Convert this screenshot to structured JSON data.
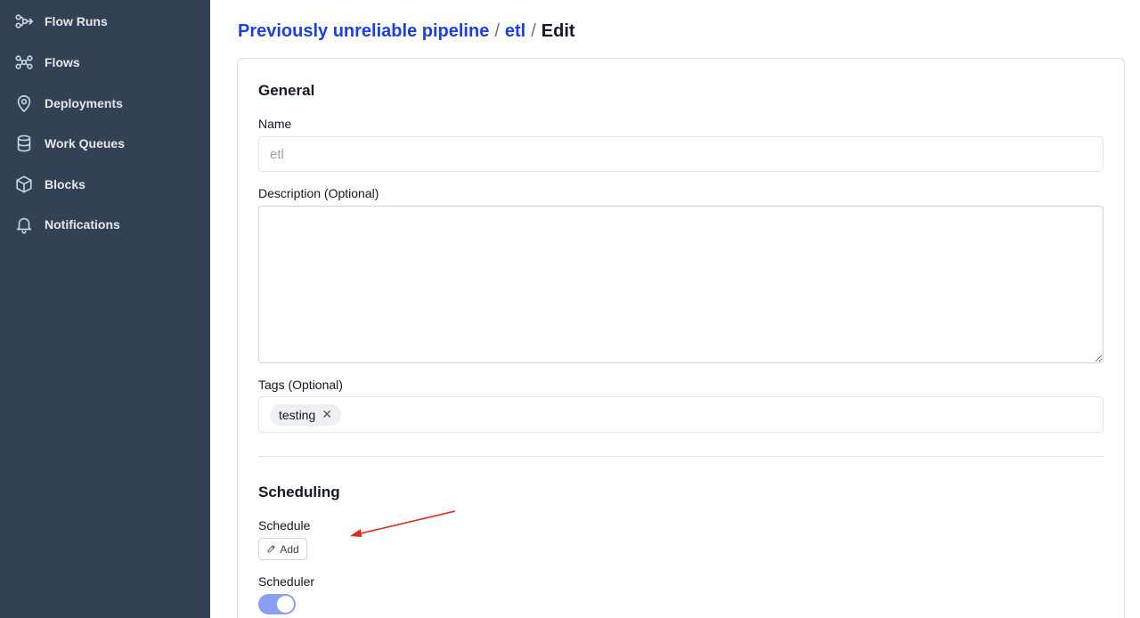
{
  "sidebar": {
    "items": [
      {
        "label": "Flow Runs",
        "icon": "flow-runs-icon"
      },
      {
        "label": "Flows",
        "icon": "flows-icon"
      },
      {
        "label": "Deployments",
        "icon": "map-pin-icon"
      },
      {
        "label": "Work Queues",
        "icon": "database-icon"
      },
      {
        "label": "Blocks",
        "icon": "cube-icon"
      },
      {
        "label": "Notifications",
        "icon": "bell-icon"
      }
    ]
  },
  "breadcrumb": {
    "flow": "Previously unreliable pipeline",
    "deployment": "etl",
    "current": "Edit",
    "separator": "/"
  },
  "general": {
    "title": "General",
    "name_label": "Name",
    "name_value": "etl",
    "description_label": "Description (Optional)",
    "description_value": "",
    "tags_label": "Tags (Optional)",
    "tags": [
      "testing"
    ]
  },
  "scheduling": {
    "title": "Scheduling",
    "schedule_label": "Schedule",
    "add_label": "Add",
    "scheduler_label": "Scheduler",
    "scheduler_enabled": true
  },
  "colors": {
    "sidebar_bg": "#334155",
    "link": "#1d3fe0",
    "toggle_on": "#8b9ff0",
    "annotation_arrow": "#e0261b"
  }
}
